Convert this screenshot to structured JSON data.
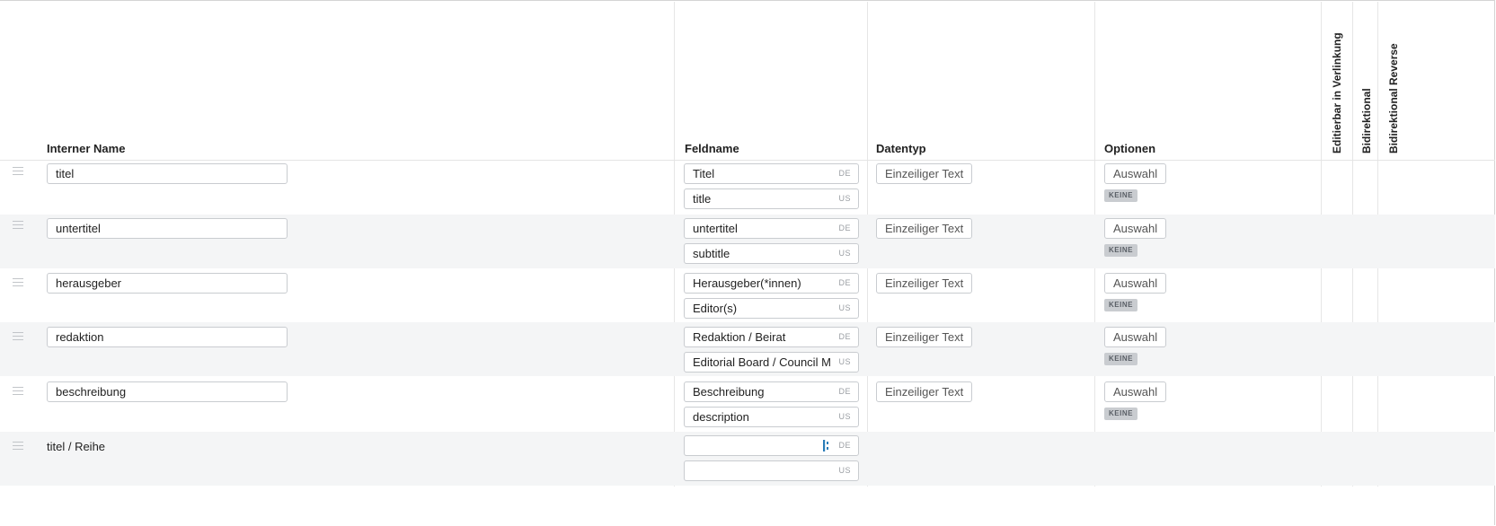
{
  "header": {
    "col_internal": "Interner Name",
    "col_fieldname": "Feldname",
    "col_datatype": "Datentyp",
    "col_options": "Optionen",
    "col_editable": "Editierbar in Verlinkung",
    "col_bidirectional": "Bidirektional",
    "col_bidirectional_reverse": "Bidirektional Reverse"
  },
  "rows": [
    {
      "internal": "titel",
      "de": "Titel",
      "us": "title",
      "datatype": "Einzeiliger Text",
      "options_button": "Auswahl",
      "options_badge": "KEINE"
    },
    {
      "internal": "untertitel",
      "de": "untertitel",
      "us": "subtitle",
      "datatype": "Einzeiliger Text",
      "options_button": "Auswahl",
      "options_badge": "KEINE"
    },
    {
      "internal": "herausgeber",
      "de": "Herausgeber(*innen)",
      "us": "Editor(s)",
      "datatype": "Einzeiliger Text",
      "options_button": "Auswahl",
      "options_badge": "KEINE"
    },
    {
      "internal": "redaktion",
      "de": "Redaktion / Beirat",
      "us": "Editorial Board / Council M",
      "datatype": "Einzeiliger Text",
      "options_button": "Auswahl",
      "options_badge": "KEINE"
    },
    {
      "internal": "beschreibung",
      "de": "Beschreibung",
      "us": "description",
      "datatype": "Einzeiliger Text",
      "options_button": "Auswahl",
      "options_badge": "KEINE"
    }
  ],
  "last_row": {
    "internal": "titel / Reihe",
    "de": "",
    "us": ""
  },
  "lang": {
    "de": "DE",
    "us": "US"
  },
  "colors": {
    "alt_row": "#f4f5f6",
    "border": "#c9ccd0",
    "badge_bg": "#c9ccd0"
  }
}
